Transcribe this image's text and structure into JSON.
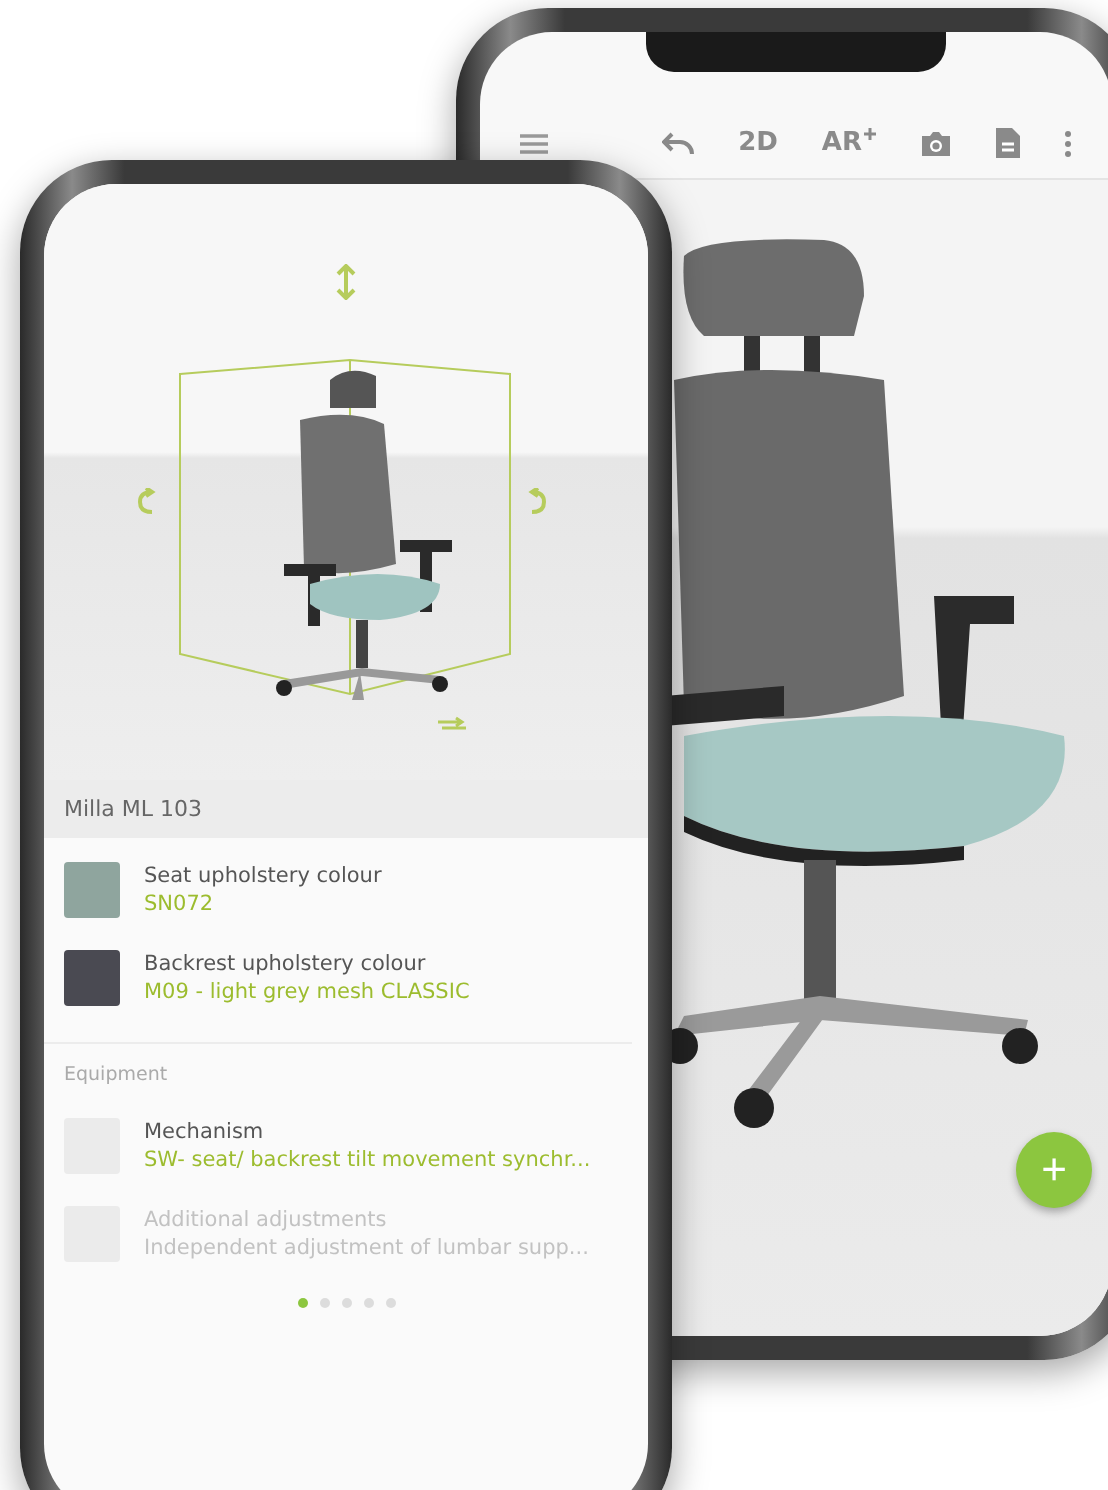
{
  "back_phone": {
    "toolbar": {
      "buttons": [
        {
          "kind": "menu"
        },
        {
          "kind": "undo"
        },
        {
          "kind": "text",
          "label": "2D"
        },
        {
          "kind": "ar",
          "label": "AR"
        },
        {
          "kind": "camera"
        },
        {
          "kind": "document"
        },
        {
          "kind": "more"
        }
      ]
    },
    "fab": "+"
  },
  "front_phone": {
    "product_name": "Milla ML 103",
    "options": [
      {
        "label": "Seat upholstery colour",
        "value": "SN072",
        "color": "#8fa59e"
      },
      {
        "label": "Backrest upholstery colour",
        "value": "M09 - light grey mesh CLASSIC",
        "color": "#4a4a52"
      }
    ],
    "section_title": "Equipment",
    "equipment": [
      {
        "label": "Mechanism",
        "value": "SW- seat/ backrest tilt movement synchr...",
        "disabled": false
      },
      {
        "label": "Additional adjustments",
        "value": "Independent adjustment of lumbar supp...",
        "disabled": true
      }
    ],
    "pager": [
      {
        "selected": true
      },
      {
        "selected": false
      },
      {
        "selected": false
      },
      {
        "selected": false
      },
      {
        "selected": false
      }
    ]
  }
}
